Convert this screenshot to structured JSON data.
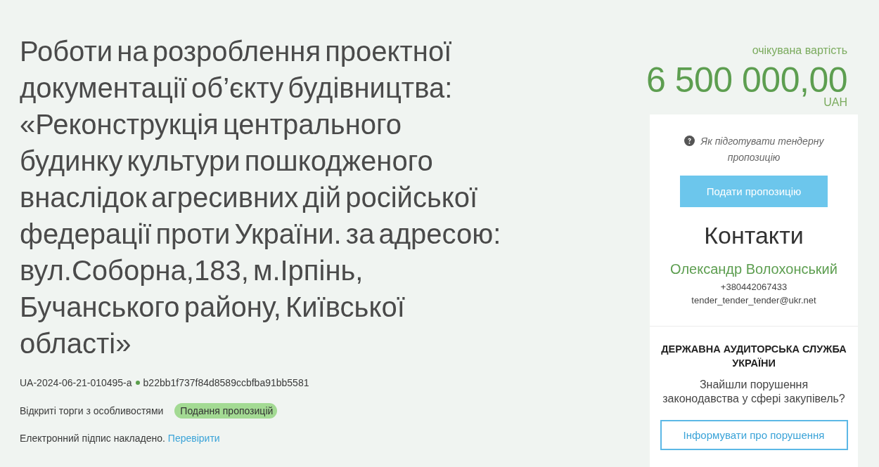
{
  "tender": {
    "title": "Роботи на розроблення проектної документації об’єкту будівництва: «Реконструкція центрального будинку культури пошкодженого внаслідок агресивних дій російської федерації проти України. за адресою: вул.Соборна,183, м.Ірпінь, Бучанського району, Київської області»",
    "id": "UA-2024-06-21-010495-a",
    "hash": "b22bb1f737f84d8589ccbfba91bb5581",
    "procedure": "Відкриті торги з особливостями",
    "status": "Подання пропозицій",
    "signature": {
      "text": "Електронний підпис накладено.",
      "link": "Перевірити"
    }
  },
  "price": {
    "label": "очікувана вартість",
    "amount": "6 500 000,00",
    "currency": "UAH"
  },
  "sidebar": {
    "help_link": "Як підготувати тендерну пропозицію",
    "submit_button": "Подати пропозицію",
    "contacts": {
      "heading": "Контакти",
      "name": "Олександр Волохонський",
      "phone": "+380442067433",
      "email": "tender_tender_tender@ukr.net"
    },
    "audit": {
      "heading": "ДЕРЖАВНА АУДИТОРСЬКА СЛУЖБА УКРАЇНИ",
      "question": "Знайшли порушення законодавства у сфері закупівель?",
      "button": "Інформувати про порушення"
    }
  }
}
